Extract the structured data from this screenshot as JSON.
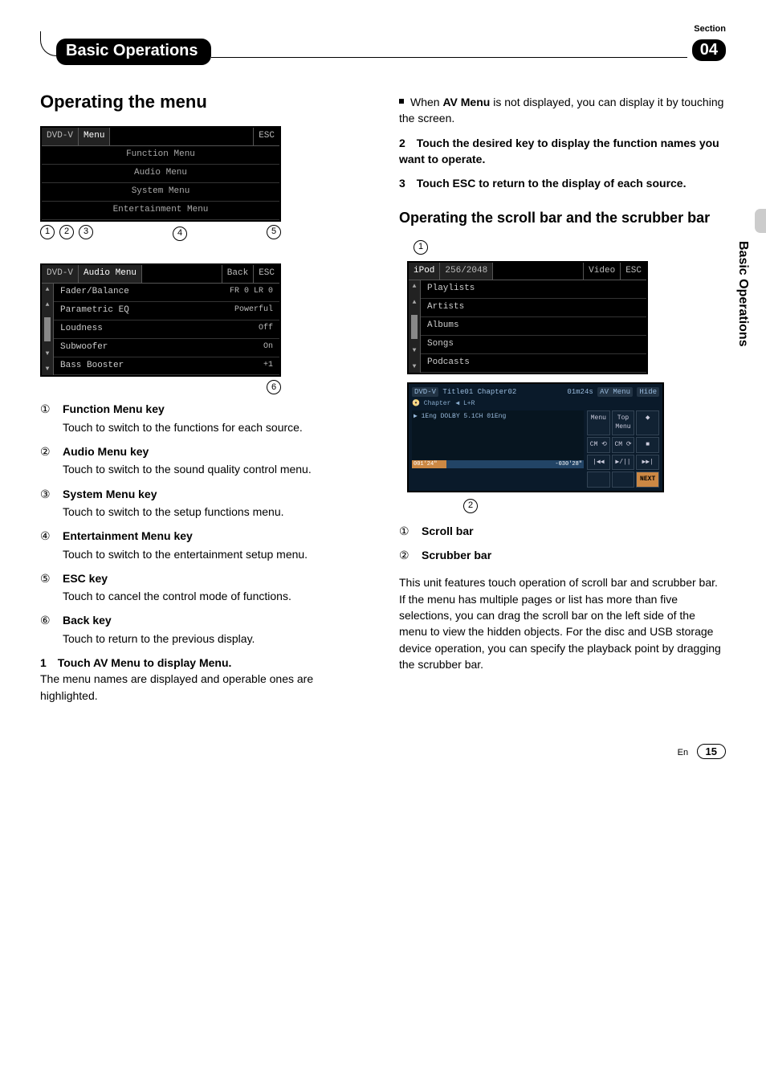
{
  "meta": {
    "section_label": "Section",
    "section_number": "04",
    "chapter_title": "Basic Operations",
    "side_label": "Basic Operations",
    "lang": "En",
    "page_number": "15"
  },
  "left": {
    "heading": "Operating the menu",
    "menu_shot": {
      "source": "DVD-V",
      "title": "Menu",
      "esc": "ESC",
      "rows": [
        "Function Menu",
        "Audio Menu",
        "System Menu",
        "Entertainment Menu"
      ],
      "callouts": [
        "1",
        "2",
        "3",
        "4",
        "5"
      ]
    },
    "audio_shot": {
      "source": "DVD-V",
      "title": "Audio Menu",
      "back": "Back",
      "esc": "ESC",
      "rows": [
        {
          "label": "Fader/Balance",
          "val": "FR 0 LR 0"
        },
        {
          "label": "Parametric EQ",
          "val": "Powerful"
        },
        {
          "label": "Loudness",
          "val": "Off"
        },
        {
          "label": "Subwoofer",
          "val": "On"
        },
        {
          "label": "Bass Booster",
          "val": "+1"
        }
      ],
      "callout": "6"
    },
    "defs": [
      {
        "num": "①",
        "title": "Function Menu key",
        "desc": "Touch to switch to the functions for each source."
      },
      {
        "num": "②",
        "title": "Audio Menu key",
        "desc": "Touch to switch to the sound quality control menu."
      },
      {
        "num": "③",
        "title": "System Menu key",
        "desc": "Touch to switch to the setup functions menu."
      },
      {
        "num": "④",
        "title": "Entertainment Menu key",
        "desc": "Touch to switch to the entertainment setup menu."
      },
      {
        "num": "⑤",
        "title": "ESC key",
        "desc": "Touch to cancel the control mode of functions."
      },
      {
        "num": "⑥",
        "title": "Back key",
        "desc": "Touch to return to the previous display."
      }
    ],
    "step1_num": "1",
    "step1_text": "Touch AV Menu to display Menu.",
    "step1_desc": "The menu names are displayed and operable ones are highlighted."
  },
  "right": {
    "note_prefix": "When ",
    "note_bold": "AV Menu",
    "note_suffix": " is not displayed, you can display it by touching the screen.",
    "step2_num": "2",
    "step2_text": "Touch the desired key to display the function names you want to operate.",
    "step3_num": "3",
    "step3_text": "Touch ESC to return to the display of each source.",
    "heading2": "Operating the scroll bar and the scrubber bar",
    "ipod_shot": {
      "source": "iPod",
      "counter": "256/2048",
      "video": "Video",
      "esc": "ESC",
      "rows": [
        "Playlists",
        "Artists",
        "Albums",
        "Songs",
        "Podcasts"
      ],
      "callout": "1"
    },
    "play_shot": {
      "source": "DVD-V",
      "title": "Title01",
      "chapter": "Chapter02",
      "time": "01m24s",
      "av": "AV Menu",
      "hide": "Hide",
      "sub1": "Chapter",
      "sub2": "L+R",
      "info": "1Eng DOLBY 5.1CH 01Eng",
      "scrub_left": "001'24\"",
      "scrub_right": "-030'28\"",
      "ctrl": [
        "Menu",
        "Top Menu",
        "⬥",
        "CM ⟲",
        "CM ⟳",
        "■",
        "|◀◀",
        "▶/||",
        "▶▶|"
      ],
      "next": "NEXT",
      "callout": "2"
    },
    "defs2": [
      {
        "num": "①",
        "title": "Scroll bar"
      },
      {
        "num": "②",
        "title": "Scrubber bar"
      }
    ],
    "para": "This unit features touch operation of scroll bar and scrubber bar.\nIf the menu has multiple pages or list has more than five selections, you can drag the scroll bar on the left side of the menu to view the hidden objects. For the disc and USB storage device operation, you can specify the playback point by dragging the scrubber bar."
  }
}
